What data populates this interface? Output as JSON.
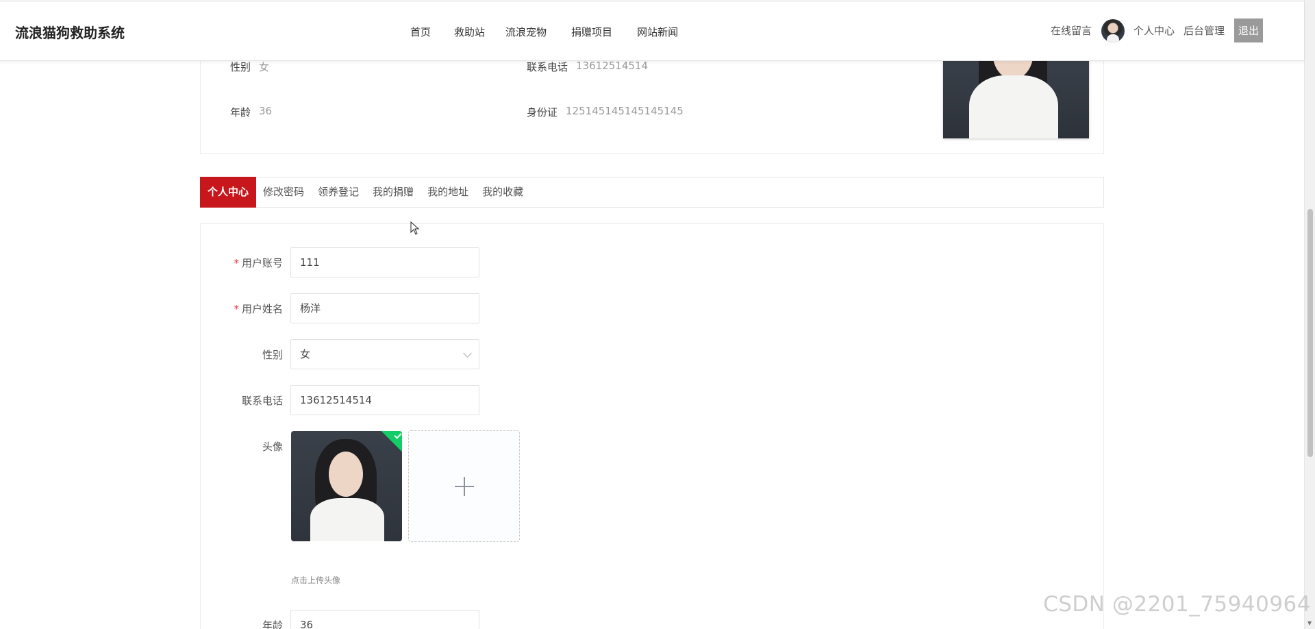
{
  "header": {
    "brand": "流浪猫狗救助系统",
    "nav": [
      "首页",
      "救助站",
      "流浪宠物",
      "捐赠项目",
      "网站新闻"
    ],
    "right": {
      "message": "在线留言",
      "user_center": "个人中心",
      "admin": "后台管理",
      "logout": "退出"
    }
  },
  "profile": {
    "gender_label": "性别",
    "gender_value": "女",
    "phone_label": "联系电话",
    "phone_value": "13612514514",
    "age_label": "年龄",
    "age_value": "36",
    "id_label": "身份证",
    "id_value": "125145145145145145"
  },
  "tabs": [
    "个人中心",
    "修改密码",
    "领养登记",
    "我的捐赠",
    "我的地址",
    "我的收藏"
  ],
  "form": {
    "account_label": "用户账号",
    "account_value": "111",
    "name_label": "用户姓名",
    "name_value": "杨洋",
    "gender_label": "性别",
    "gender_value": "女",
    "phone_label": "联系电话",
    "phone_value": "13612514514",
    "avatar_label": "头像",
    "upload_tip": "点击上传头像",
    "age_label": "年龄",
    "age_value": "36",
    "required_mark": "*"
  },
  "watermark": "CSDN @2201_75940964",
  "icons": {
    "avatar": "avatar-icon",
    "select_arrow": "chevron-down-icon",
    "upload_plus": "plus-icon",
    "upload_success": "check-icon",
    "cursor": "mouse-cursor-icon"
  },
  "colors": {
    "accent": "#c8161d",
    "logout_bg": "#9a9a9a",
    "success": "#13ce66"
  }
}
